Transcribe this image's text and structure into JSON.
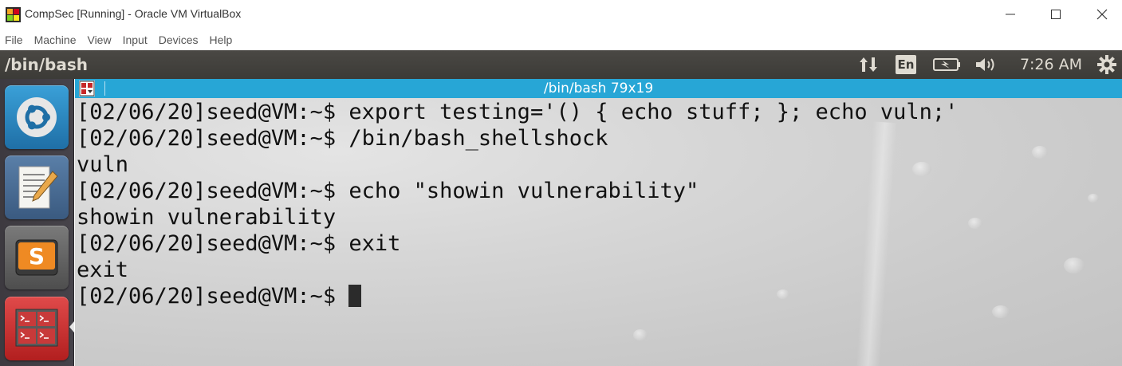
{
  "window": {
    "title": "CompSec [Running] - Oracle VM VirtualBox"
  },
  "menu": [
    "File",
    "Machine",
    "View",
    "Input",
    "Devices",
    "Help"
  ],
  "panel": {
    "title": "/bin/bash",
    "language": "En",
    "clock": "7:26 AM"
  },
  "launcher": [
    {
      "name": "ubuntu-dash-icon"
    },
    {
      "name": "text-editor-icon"
    },
    {
      "name": "sublime-text-icon"
    },
    {
      "name": "terminal-icon",
      "active": true
    }
  ],
  "terminal": {
    "title": "/bin/bash 79x19",
    "lines": [
      "[02/06/20]seed@VM:~$ export testing='() { echo stuff; }; echo vuln;'",
      "[02/06/20]seed@VM:~$ /bin/bash_shellshock",
      "vuln",
      "[02/06/20]seed@VM:~$ echo \"showin vulnerability\"",
      "showin vulnerability",
      "[02/06/20]seed@VM:~$ exit",
      "exit",
      "[02/06/20]seed@VM:~$ "
    ]
  },
  "colors": {
    "panel_bg": "#3c3b37",
    "terminal_titlebar": "#27a6d6",
    "launcher_bg": "#3d3a40"
  }
}
